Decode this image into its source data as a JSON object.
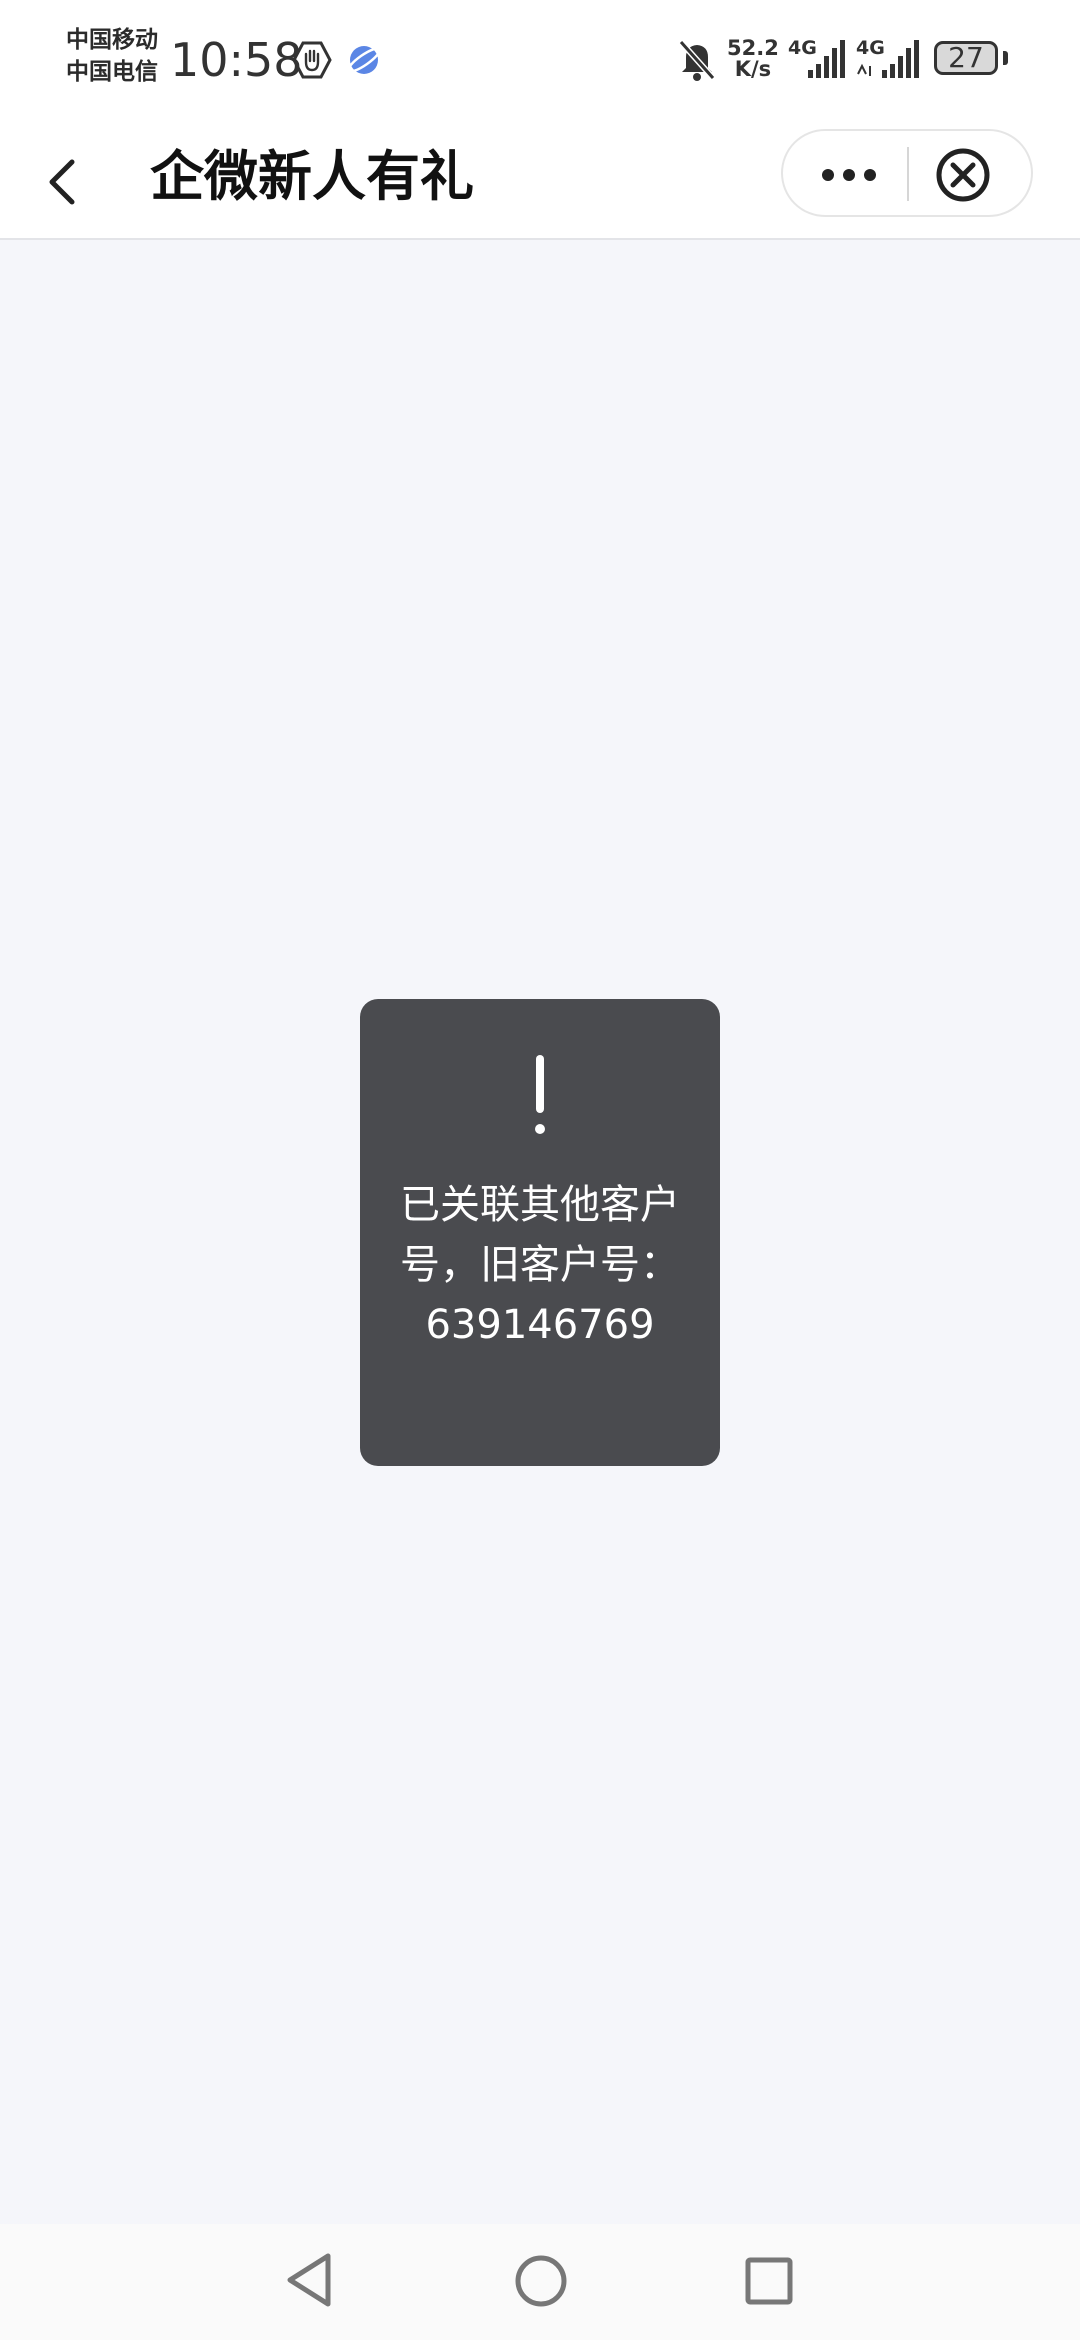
{
  "status_bar": {
    "carrier_1": "中国移动",
    "carrier_2": "中国电信",
    "time": "10:58",
    "net_speed_value": "52.2",
    "net_speed_unit": "K/s",
    "signal_1_label": "4G",
    "signal_2_label": "4G",
    "battery": "27",
    "icons": [
      "hand-hexagon-icon",
      "planet-app-icon",
      "bell-muted-icon",
      "signal-bars-icon",
      "battery-icon"
    ]
  },
  "nav_bar": {
    "title": "企微新人有礼",
    "icons": [
      "chevron-left-icon",
      "more-dots-icon",
      "close-circle-icon"
    ]
  },
  "toast": {
    "icon": "exclamation-icon",
    "message": "已关联其他客户号，旧客户号：639146769"
  },
  "system_nav": {
    "icons": [
      "triangle-back-icon",
      "circle-home-icon",
      "square-recents-icon"
    ]
  },
  "colors": {
    "page_background": "#f5f6fa",
    "toast_background": "#4a4b4f",
    "planet_icon": "#5b86e5"
  }
}
